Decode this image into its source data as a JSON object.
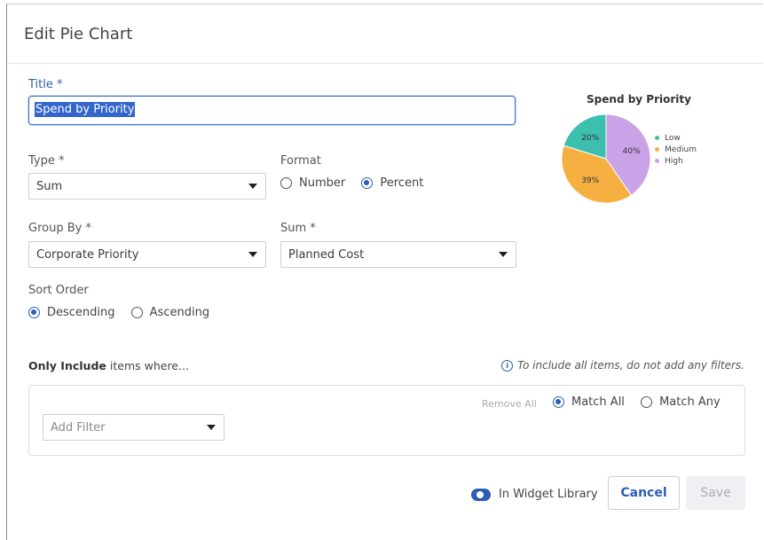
{
  "dialog": {
    "title": "Edit Pie Chart"
  },
  "form": {
    "title_label": "Title",
    "required_mark": "*",
    "title_value": "Spend by Priority",
    "type_label": "Type",
    "type_value": "Sum",
    "format_label": "Format",
    "format_options": [
      "Number",
      "Percent"
    ],
    "format_selected": "Percent",
    "group_by_label": "Group By",
    "group_by_value": "Corporate Priority",
    "sum_label": "Sum",
    "sum_value": "Planned Cost",
    "sort_label": "Sort Order",
    "sort_options": [
      "Descending",
      "Ascending"
    ],
    "sort_selected": "Descending"
  },
  "filters": {
    "head_bold": "Only Include",
    "head_rest": "items where...",
    "hint": "To include all items, do not add any filters.",
    "remove_all": "Remove All",
    "match_options": [
      "Match All",
      "Match Any"
    ],
    "match_selected": "Match All",
    "add_filter_placeholder": "Add Filter"
  },
  "footer": {
    "widget_library_label": "In Widget Library",
    "widget_library_on": true,
    "cancel_label": "Cancel",
    "save_label": "Save"
  },
  "colors": {
    "accent": "#2b5db4",
    "low": "#3dbfb0",
    "medium": "#f5b041",
    "high": "#c9a2e8"
  },
  "chart_data": {
    "type": "pie",
    "title": "Spend by Priority",
    "categories": [
      "Low",
      "Medium",
      "High"
    ],
    "values": [
      20,
      39,
      40
    ],
    "labels": [
      "20%",
      "39%",
      "40%"
    ],
    "colors": [
      "#3dbfb0",
      "#f5b041",
      "#c9a2e8"
    ],
    "legend": "right"
  }
}
